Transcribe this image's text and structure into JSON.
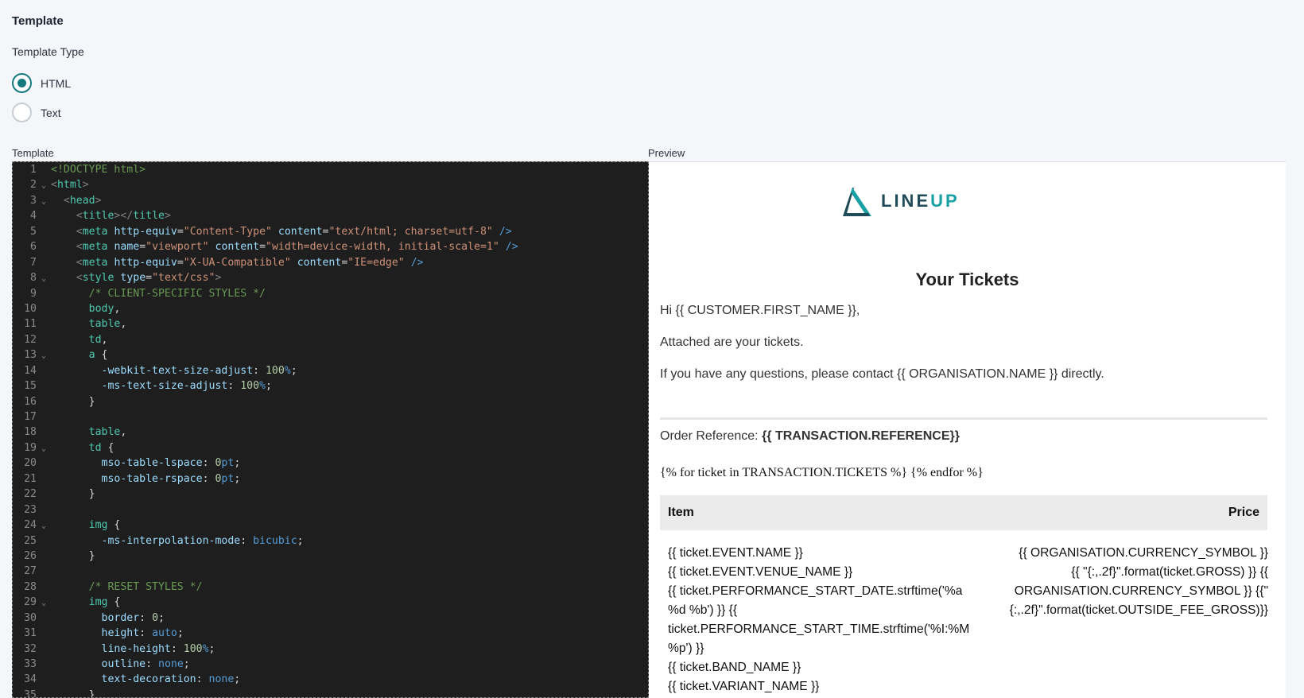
{
  "header": {
    "title": "Template",
    "type_label": "Template Type"
  },
  "template_type": {
    "options": [
      {
        "label": "HTML",
        "checked": true
      },
      {
        "label": "Text",
        "checked": false
      }
    ]
  },
  "panels": {
    "template_label": "Template",
    "preview_label": "Preview"
  },
  "editor": {
    "lines": [
      {
        "n": "1",
        "fold": false,
        "html": "<span class='c-cm'>&lt;!DOCTYPE html&gt;</span>"
      },
      {
        "n": "2",
        "fold": true,
        "html": "<span class='c-bracket'>&lt;</span><span class='c-tag'>html</span><span class='c-bracket'>&gt;</span>"
      },
      {
        "n": "3",
        "fold": true,
        "html": "  <span class='c-bracket'>&lt;</span><span class='c-tag'>head</span><span class='c-bracket'>&gt;</span>"
      },
      {
        "n": "4",
        "fold": false,
        "html": "    <span class='c-bracket'>&lt;</span><span class='c-tag'>title</span><span class='c-bracket'>&gt;&lt;/</span><span class='c-tag'>title</span><span class='c-bracket'>&gt;</span>"
      },
      {
        "n": "5",
        "fold": false,
        "html": "    <span class='c-bracket'>&lt;</span><span class='c-tag'>meta</span> <span class='c-attr'>http-equiv</span>=<span class='c-str'>\"Content-Type\"</span> <span class='c-attr'>content</span>=<span class='c-str'>\"text/html; charset=utf-8\"</span> <span class='c-kw'>/&gt;</span>"
      },
      {
        "n": "6",
        "fold": false,
        "html": "    <span class='c-bracket'>&lt;</span><span class='c-tag'>meta</span> <span class='c-attr'>name</span>=<span class='c-str'>\"viewport\"</span> <span class='c-attr'>content</span>=<span class='c-str'>\"width=device-width, initial-scale=1\"</span> <span class='c-kw'>/&gt;</span>"
      },
      {
        "n": "7",
        "fold": false,
        "html": "    <span class='c-bracket'>&lt;</span><span class='c-tag'>meta</span> <span class='c-attr'>http-equiv</span>=<span class='c-str'>\"X-UA-Compatible\"</span> <span class='c-attr'>content</span>=<span class='c-str'>\"IE=edge\"</span> <span class='c-kw'>/&gt;</span>"
      },
      {
        "n": "8",
        "fold": true,
        "html": "    <span class='c-bracket'>&lt;</span><span class='c-tag'>style</span> <span class='c-attr'>type</span>=<span class='c-str'>\"text/css\"</span><span class='c-bracket'>&gt;</span>"
      },
      {
        "n": "9",
        "fold": false,
        "html": "      <span class='c-cm'>/* CLIENT-SPECIFIC STYLES */</span>"
      },
      {
        "n": "10",
        "fold": false,
        "html": "      <span class='c-tag'>body</span>,"
      },
      {
        "n": "11",
        "fold": false,
        "html": "      <span class='c-tag'>table</span>,"
      },
      {
        "n": "12",
        "fold": false,
        "html": "      <span class='c-tag'>td</span>,"
      },
      {
        "n": "13",
        "fold": true,
        "html": "      <span class='c-tag'>a</span> {"
      },
      {
        "n": "14",
        "fold": false,
        "html": "        <span class='c-prop'>-webkit-text-size-adjust</span>: <span class='c-num'>100</span><span class='c-kw'>%</span>;"
      },
      {
        "n": "15",
        "fold": false,
        "html": "        <span class='c-prop'>-ms-text-size-adjust</span>: <span class='c-num'>100</span><span class='c-kw'>%</span>;"
      },
      {
        "n": "16",
        "fold": false,
        "html": "      }"
      },
      {
        "n": "17",
        "fold": false,
        "html": ""
      },
      {
        "n": "18",
        "fold": false,
        "html": "      <span class='c-tag'>table</span>,"
      },
      {
        "n": "19",
        "fold": true,
        "html": "      <span class='c-tag'>td</span> {"
      },
      {
        "n": "20",
        "fold": false,
        "html": "        <span class='c-prop'>mso-table-lspace</span>: <span class='c-num'>0</span><span class='c-kw'>pt</span>;"
      },
      {
        "n": "21",
        "fold": false,
        "html": "        <span class='c-prop'>mso-table-rspace</span>: <span class='c-num'>0</span><span class='c-kw'>pt</span>;"
      },
      {
        "n": "22",
        "fold": false,
        "html": "      }"
      },
      {
        "n": "23",
        "fold": false,
        "html": ""
      },
      {
        "n": "24",
        "fold": true,
        "html": "      <span class='c-tag'>img</span> {"
      },
      {
        "n": "25",
        "fold": false,
        "html": "        <span class='c-prop'>-ms-interpolation-mode</span>: <span class='c-kw'>bicubic</span>;"
      },
      {
        "n": "26",
        "fold": false,
        "html": "      }"
      },
      {
        "n": "27",
        "fold": false,
        "html": ""
      },
      {
        "n": "28",
        "fold": false,
        "html": "      <span class='c-cm'>/* RESET STYLES */</span>"
      },
      {
        "n": "29",
        "fold": true,
        "html": "      <span class='c-tag'>img</span> {"
      },
      {
        "n": "30",
        "fold": false,
        "html": "        <span class='c-prop'>border</span>: <span class='c-num'>0</span>;"
      },
      {
        "n": "31",
        "fold": false,
        "html": "        <span class='c-prop'>height</span>: <span class='c-kw'>auto</span>;"
      },
      {
        "n": "32",
        "fold": false,
        "html": "        <span class='c-prop'>line-height</span>: <span class='c-num'>100</span><span class='c-kw'>%</span>;"
      },
      {
        "n": "33",
        "fold": false,
        "html": "        <span class='c-prop'>outline</span>: <span class='c-kw'>none</span>;"
      },
      {
        "n": "34",
        "fold": false,
        "html": "        <span class='c-prop'>text-decoration</span>: <span class='c-kw'>none</span>;"
      },
      {
        "n": "35",
        "fold": false,
        "html": "      }"
      }
    ]
  },
  "preview": {
    "logo": {
      "text_a": "LINE",
      "text_b": "UP",
      "icon": "lineup-logo-icon",
      "colors": {
        "dark": "#1f4a57",
        "accent": "#18a0a4"
      }
    },
    "title": "Your Tickets",
    "greeting": "Hi {{ CUSTOMER.FIRST_NAME }},",
    "line1": "Attached are your tickets.",
    "line2": "If you have any questions, please contact {{ ORGANISATION.NAME }} directly.",
    "order_label": "Order Reference: ",
    "order_value": "{{ TRANSACTION.REFERENCE}}",
    "loop_text": "{% for ticket in TRANSACTION.TICKETS %} {% endfor %}",
    "table": {
      "col_item": "Item",
      "col_price": "Price",
      "item_lines": [
        "{{ ticket.EVENT.NAME }}",
        "{{ ticket.EVENT.VENUE_NAME }}",
        "{{ ticket.PERFORMANCE_START_DATE.strftime('%a",
        "%d %b') }} {{",
        "ticket.PERFORMANCE_START_TIME.strftime('%I:%M",
        "%p') }}",
        "{{ ticket.BAND_NAME }}",
        "{{ ticket.VARIANT_NAME }}"
      ],
      "price_lines": [
        "{{ ORGANISATION.CURRENCY_SYMBOL }}",
        "{{ \"{:,.2f}\".format(ticket.GROSS) }} {{",
        "ORGANISATION.CURRENCY_SYMBOL }} {{\"",
        "{:,.2f}\".format(ticket.OUTSIDE_FEE_GROSS)}}"
      ]
    }
  },
  "colors": {
    "accent": "#147a80",
    "editor_bg": "#1e1e1e"
  }
}
